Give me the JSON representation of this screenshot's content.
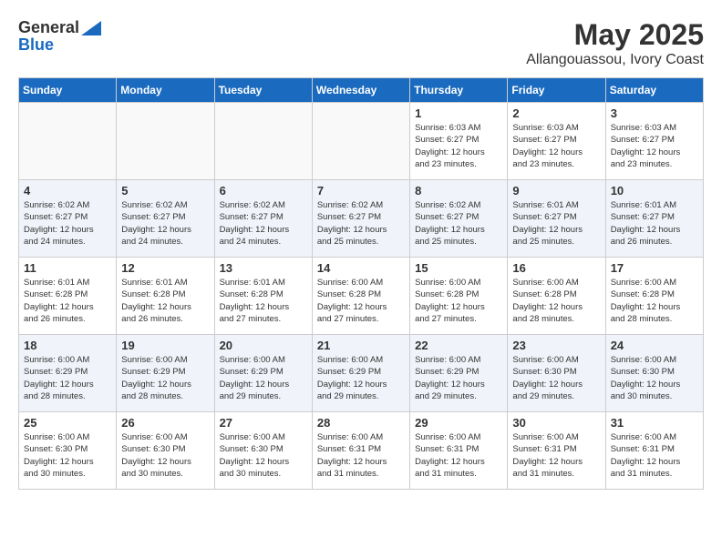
{
  "header": {
    "logo_line1": "General",
    "logo_line2": "Blue",
    "title": "May 2025",
    "subtitle": "Allangouassou, Ivory Coast"
  },
  "calendar": {
    "days_of_week": [
      "Sunday",
      "Monday",
      "Tuesday",
      "Wednesday",
      "Thursday",
      "Friday",
      "Saturday"
    ],
    "weeks": [
      [
        {
          "day": "",
          "info": ""
        },
        {
          "day": "",
          "info": ""
        },
        {
          "day": "",
          "info": ""
        },
        {
          "day": "",
          "info": ""
        },
        {
          "day": "1",
          "info": "Sunrise: 6:03 AM\nSunset: 6:27 PM\nDaylight: 12 hours\nand 23 minutes."
        },
        {
          "day": "2",
          "info": "Sunrise: 6:03 AM\nSunset: 6:27 PM\nDaylight: 12 hours\nand 23 minutes."
        },
        {
          "day": "3",
          "info": "Sunrise: 6:03 AM\nSunset: 6:27 PM\nDaylight: 12 hours\nand 23 minutes."
        }
      ],
      [
        {
          "day": "4",
          "info": "Sunrise: 6:02 AM\nSunset: 6:27 PM\nDaylight: 12 hours\nand 24 minutes."
        },
        {
          "day": "5",
          "info": "Sunrise: 6:02 AM\nSunset: 6:27 PM\nDaylight: 12 hours\nand 24 minutes."
        },
        {
          "day": "6",
          "info": "Sunrise: 6:02 AM\nSunset: 6:27 PM\nDaylight: 12 hours\nand 24 minutes."
        },
        {
          "day": "7",
          "info": "Sunrise: 6:02 AM\nSunset: 6:27 PM\nDaylight: 12 hours\nand 25 minutes."
        },
        {
          "day": "8",
          "info": "Sunrise: 6:02 AM\nSunset: 6:27 PM\nDaylight: 12 hours\nand 25 minutes."
        },
        {
          "day": "9",
          "info": "Sunrise: 6:01 AM\nSunset: 6:27 PM\nDaylight: 12 hours\nand 25 minutes."
        },
        {
          "day": "10",
          "info": "Sunrise: 6:01 AM\nSunset: 6:27 PM\nDaylight: 12 hours\nand 26 minutes."
        }
      ],
      [
        {
          "day": "11",
          "info": "Sunrise: 6:01 AM\nSunset: 6:28 PM\nDaylight: 12 hours\nand 26 minutes."
        },
        {
          "day": "12",
          "info": "Sunrise: 6:01 AM\nSunset: 6:28 PM\nDaylight: 12 hours\nand 26 minutes."
        },
        {
          "day": "13",
          "info": "Sunrise: 6:01 AM\nSunset: 6:28 PM\nDaylight: 12 hours\nand 27 minutes."
        },
        {
          "day": "14",
          "info": "Sunrise: 6:00 AM\nSunset: 6:28 PM\nDaylight: 12 hours\nand 27 minutes."
        },
        {
          "day": "15",
          "info": "Sunrise: 6:00 AM\nSunset: 6:28 PM\nDaylight: 12 hours\nand 27 minutes."
        },
        {
          "day": "16",
          "info": "Sunrise: 6:00 AM\nSunset: 6:28 PM\nDaylight: 12 hours\nand 28 minutes."
        },
        {
          "day": "17",
          "info": "Sunrise: 6:00 AM\nSunset: 6:28 PM\nDaylight: 12 hours\nand 28 minutes."
        }
      ],
      [
        {
          "day": "18",
          "info": "Sunrise: 6:00 AM\nSunset: 6:29 PM\nDaylight: 12 hours\nand 28 minutes."
        },
        {
          "day": "19",
          "info": "Sunrise: 6:00 AM\nSunset: 6:29 PM\nDaylight: 12 hours\nand 28 minutes."
        },
        {
          "day": "20",
          "info": "Sunrise: 6:00 AM\nSunset: 6:29 PM\nDaylight: 12 hours\nand 29 minutes."
        },
        {
          "day": "21",
          "info": "Sunrise: 6:00 AM\nSunset: 6:29 PM\nDaylight: 12 hours\nand 29 minutes."
        },
        {
          "day": "22",
          "info": "Sunrise: 6:00 AM\nSunset: 6:29 PM\nDaylight: 12 hours\nand 29 minutes."
        },
        {
          "day": "23",
          "info": "Sunrise: 6:00 AM\nSunset: 6:30 PM\nDaylight: 12 hours\nand 29 minutes."
        },
        {
          "day": "24",
          "info": "Sunrise: 6:00 AM\nSunset: 6:30 PM\nDaylight: 12 hours\nand 30 minutes."
        }
      ],
      [
        {
          "day": "25",
          "info": "Sunrise: 6:00 AM\nSunset: 6:30 PM\nDaylight: 12 hours\nand 30 minutes."
        },
        {
          "day": "26",
          "info": "Sunrise: 6:00 AM\nSunset: 6:30 PM\nDaylight: 12 hours\nand 30 minutes."
        },
        {
          "day": "27",
          "info": "Sunrise: 6:00 AM\nSunset: 6:30 PM\nDaylight: 12 hours\nand 30 minutes."
        },
        {
          "day": "28",
          "info": "Sunrise: 6:00 AM\nSunset: 6:31 PM\nDaylight: 12 hours\nand 31 minutes."
        },
        {
          "day": "29",
          "info": "Sunrise: 6:00 AM\nSunset: 6:31 PM\nDaylight: 12 hours\nand 31 minutes."
        },
        {
          "day": "30",
          "info": "Sunrise: 6:00 AM\nSunset: 6:31 PM\nDaylight: 12 hours\nand 31 minutes."
        },
        {
          "day": "31",
          "info": "Sunrise: 6:00 AM\nSunset: 6:31 PM\nDaylight: 12 hours\nand 31 minutes."
        }
      ]
    ]
  }
}
